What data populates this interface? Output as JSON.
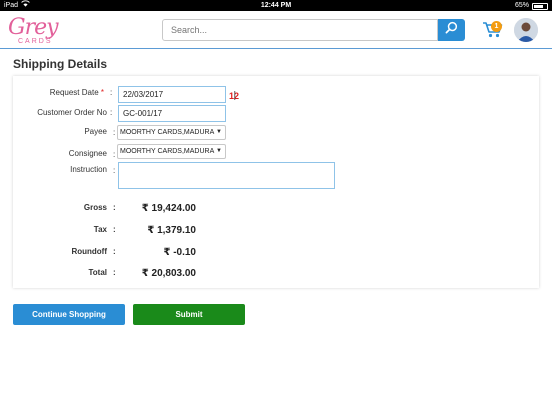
{
  "status_bar": {
    "device": "iPad",
    "time": "12:44 PM",
    "battery": "65%"
  },
  "header": {
    "logo_text": "Grey",
    "logo_sub": "CARDS",
    "search_placeholder": "Search...",
    "cart_count": "1"
  },
  "page": {
    "title": "Shipping Details"
  },
  "form": {
    "request_date_label": "Request Date",
    "request_date_required": "*",
    "request_date_value": "22/03/2017",
    "calendar_icon_text": "12",
    "customer_order_label": "Customer Order No",
    "customer_order_value": "GC-001/17",
    "payee_label": "Payee",
    "payee_value": "MOORTHY CARDS,MADURA",
    "consignee_label": "Consignee",
    "consignee_value": "MOORTHY CARDS,MADURA",
    "instruction_label": "Instruction",
    "instruction_value": ""
  },
  "totals": [
    {
      "label": "Gross",
      "value": "₹ 19,424.00"
    },
    {
      "label": "Tax",
      "value": "₹ 1,379.10"
    },
    {
      "label": "Roundoff",
      "value": "₹ -0.10"
    },
    {
      "label": "Total",
      "value": "₹ 20,803.00"
    }
  ],
  "buttons": {
    "continue_label": "Continue Shopping",
    "submit_label": "Submit"
  },
  "colors": {
    "accent_blue": "#2a8dd4",
    "submit_green": "#1a8a1a",
    "logo_pink": "#e2609a",
    "badge_orange": "#f39c12"
  }
}
